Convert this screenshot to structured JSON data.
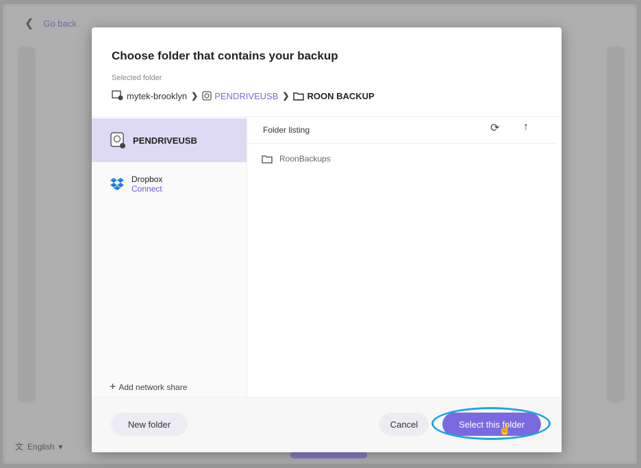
{
  "background": {
    "back_label": "Go back",
    "language": "English"
  },
  "dialog": {
    "title": "Choose folder that contains your backup",
    "selected_label": "Selected folder",
    "breadcrumb": [
      "mytek-brooklyn",
      "PENDRIVEUSB",
      "ROON BACKUP"
    ],
    "sources": [
      {
        "name": "PENDRIVEUSB",
        "icon": "usb-drive-icon"
      },
      {
        "name": "Dropbox",
        "sub": "Connect",
        "icon": "dropbox-icon"
      }
    ],
    "add_network_share": "Add network share",
    "listing_title": "Folder listing",
    "folders": [
      "RoonBackups"
    ],
    "buttons": {
      "new_folder": "New folder",
      "cancel": "Cancel",
      "select": "Select this folder"
    }
  },
  "colors": {
    "accent": "#7a6ae0",
    "selected_source_bg": "#dedaf5",
    "highlight_ring": "#19a7e0"
  }
}
